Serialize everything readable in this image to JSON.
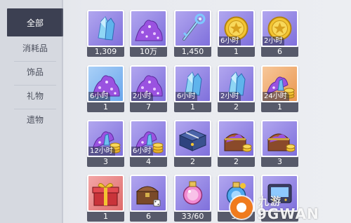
{
  "categories": [
    {
      "label": "全部",
      "active": true
    },
    {
      "label": "消耗品",
      "active": false
    },
    {
      "label": "饰品",
      "active": false
    },
    {
      "label": "礼物",
      "active": false
    },
    {
      "label": "遗物",
      "active": false
    }
  ],
  "items": [
    {
      "icon": "blue-crystal-icon",
      "frame": "purple",
      "timer": "",
      "count": "1,309"
    },
    {
      "icon": "purple-crystal-pile-icon",
      "frame": "purple",
      "timer": "",
      "count": "10万"
    },
    {
      "icon": "blue-key-icon",
      "frame": "purple",
      "timer": "",
      "count": "1,450"
    },
    {
      "icon": "gold-coin-icon",
      "frame": "purple",
      "timer": "6小时",
      "count": "1"
    },
    {
      "icon": "gold-coin-icon",
      "frame": "purple",
      "timer": "2小时",
      "count": "6"
    },
    {
      "icon": "purple-crystal-pile-icon",
      "frame": "blue",
      "timer": "6小时",
      "count": "1"
    },
    {
      "icon": "purple-crystal-pile-icon",
      "frame": "purple",
      "timer": "2小时",
      "count": "7"
    },
    {
      "icon": "blue-crystal-icon",
      "frame": "purple",
      "timer": "6小时",
      "count": "1"
    },
    {
      "icon": "blue-crystal-icon",
      "frame": "purple",
      "timer": "2小时",
      "count": "2"
    },
    {
      "icon": "crystals-and-coins-icon",
      "frame": "orange",
      "timer": "24小时",
      "count": "1"
    },
    {
      "icon": "crystals-and-coins-icon",
      "frame": "purple",
      "timer": "12小时",
      "count": "3"
    },
    {
      "icon": "crystals-and-coins-icon",
      "frame": "purple",
      "timer": "6小时",
      "count": "4"
    },
    {
      "icon": "blue-treasure-chest-icon",
      "frame": "purple",
      "timer": "",
      "count": "2"
    },
    {
      "icon": "treasure-chest-with-crystals-icon",
      "frame": "purple",
      "timer": "",
      "count": "2"
    },
    {
      "icon": "treasure-chest-with-crystals-icon",
      "frame": "purple",
      "timer": "",
      "count": "3"
    },
    {
      "icon": "red-gift-box-icon",
      "frame": "red",
      "timer": "",
      "count": "1"
    },
    {
      "icon": "wooden-chest-with-dice-icon",
      "frame": "purple",
      "timer": "",
      "count": "6"
    },
    {
      "icon": "pink-potion-icon",
      "frame": "purple",
      "timer": "",
      "count": "33/60"
    },
    {
      "icon": "blue-potion-icon",
      "frame": "purple",
      "timer": "",
      "count": "35"
    },
    {
      "icon": "ticket-device-icon",
      "frame": "purple",
      "timer": "",
      "count": ""
    }
  ],
  "watermark": {
    "cn": "九游",
    "en": "9GWAN"
  },
  "colors": {
    "sidebar_active": "#3c4052",
    "count_bar": "#575a6a",
    "frame_purple": "#8f80e2",
    "frame_blue": "#7fb4ef",
    "frame_orange": "#ef9f5a",
    "frame_red": "#e37878",
    "watermark_orange": "#f07b1e"
  }
}
